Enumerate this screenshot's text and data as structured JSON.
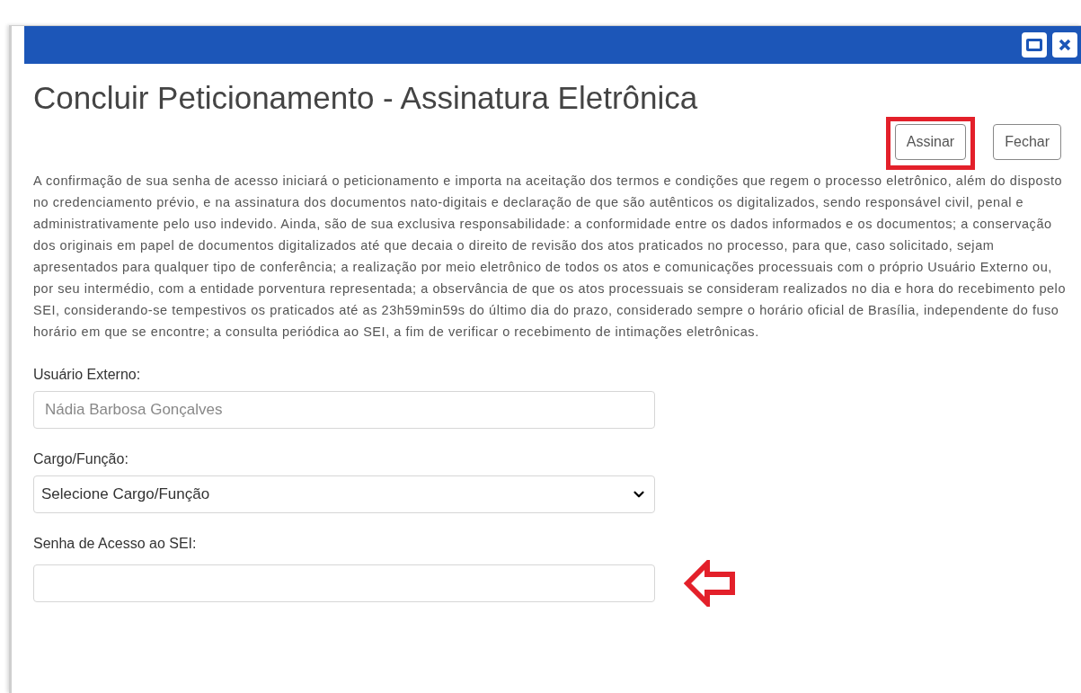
{
  "window": {
    "title": "Concluir Peticionamento - Assinatura Eletrônica"
  },
  "buttons": [
    {
      "label": "Assinar",
      "highlighted": true
    },
    {
      "label": "Fechar",
      "highlighted": false
    }
  ],
  "notice": "A confirmação de sua senha de acesso iniciará o peticionamento e importa na aceitação dos termos e condições que regem o processo eletrônico, além do disposto no credenciamento prévio, e na assinatura dos documentos nato-digitais e declaração de que são autênticos os digitalizados, sendo responsável civil, penal e administrativamente pelo uso indevido. Ainda, são de sua exclusiva responsabilidade: a conformidade entre os dados informados e os documentos; a conservação dos originais em papel de documentos digitalizados até que decaia o direito de revisão dos atos praticados no processo, para que, caso solicitado, sejam apresentados para qualquer tipo de conferência; a realização por meio eletrônico de todos os atos e comunicações processuais com o próprio Usuário Externo ou, por seu intermédio, com a entidade porventura representada; a observância de que os atos processuais se consideram realizados no dia e hora do recebimento pelo SEI, considerando-se tempestivos os praticados até as 23h59min59s do último dia do prazo, considerado sempre o horário oficial de Brasília, independente do fuso horário em que se encontre; a consulta periódica ao SEI, a fim de verificar o recebimento de intimações eletrônicas.",
  "fields": [
    {
      "kind": "text",
      "label": "Usuário Externo:",
      "value": "Nádia Barbosa Gonçalves",
      "disabled": true,
      "pointed": false
    },
    {
      "kind": "select",
      "label": "Cargo/Função:",
      "value": "Selecione Cargo/Função",
      "disabled": false,
      "pointed": false
    },
    {
      "kind": "password",
      "label": "Senha de Acesso ao SEI:",
      "disabled": false,
      "pointed": true
    }
  ]
}
